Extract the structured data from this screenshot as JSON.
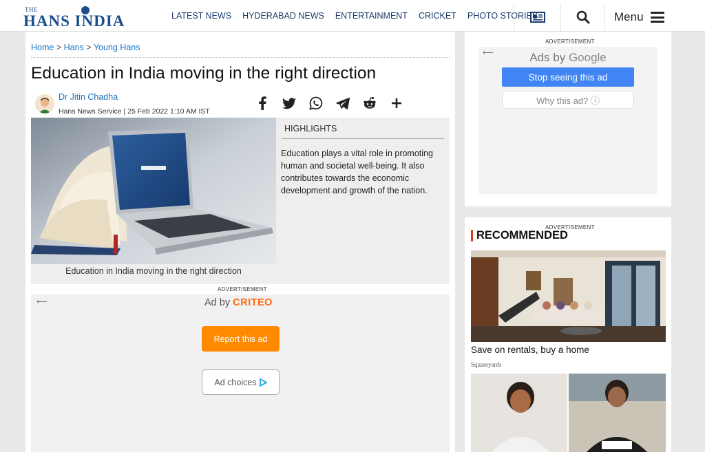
{
  "site": {
    "logo_top": "THE",
    "logo_main": "HANS INDIA"
  },
  "nav": {
    "items": [
      "LATEST NEWS",
      "HYDERABAD NEWS",
      "ENTERTAINMENT",
      "CRICKET",
      "PHOTO STORIES"
    ],
    "menu_label": "Menu"
  },
  "breadcrumb": {
    "home": "Home",
    "sep": ">",
    "section": "Hans",
    "subsection": "Young Hans"
  },
  "article": {
    "title": "Education in India moving in the right direction",
    "author": "Dr Jitin Chadha",
    "byline": "Hans News Service | 25 Feb 2022 1:10 AM IST",
    "image_caption": "Education in India moving in the right direction",
    "highlights_label": "HIGHLIGHTS",
    "highlights_text": "Education plays a vital role in promoting human and societal well-being. It also contributes towards the economic development and growth of the nation."
  },
  "share": {
    "icons": [
      "facebook-icon",
      "twitter-icon",
      "whatsapp-icon",
      "telegram-icon",
      "reddit-icon",
      "plus-icon"
    ]
  },
  "ads": {
    "label": "ADVERTISEMENT",
    "ad_by": "Ad by",
    "criteo": "CRITEO",
    "report": "Report this ad",
    "choices": "Ad choices",
    "ads_by": "Ads by",
    "google": "Google",
    "stop": "Stop seeing this ad",
    "why": "Why this ad? ⓘ"
  },
  "recommended": {
    "title": "RECOMMENDED",
    "item1_caption": "Save on rentals, buy a home",
    "item1_source": "Squareyards"
  },
  "colors": {
    "brand": "#1b4f8a",
    "link": "#1a73c0",
    "accent_red": "#e03a1e",
    "criteo_orange": "#ff8a00",
    "google_blue": "#4185f4"
  }
}
